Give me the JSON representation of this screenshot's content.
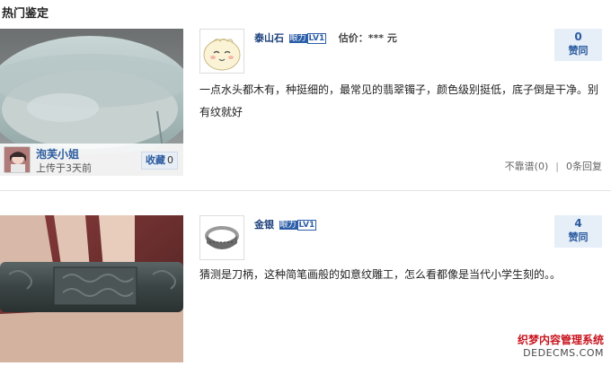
{
  "section": {
    "title": "热门鉴定"
  },
  "items": [
    {
      "uploader": {
        "name": "泡芙小姐",
        "upload_time": "上传于3天前"
      },
      "favorite": {
        "label": "收藏",
        "count": "0"
      },
      "comment": {
        "commenter": "泰山石",
        "eye_badge": [
          "眼力",
          "LV1"
        ],
        "estimate": "估价：*** 元",
        "text": "一点水头都木有，种挺细的，最常见的翡翠镯子，颜色级别挺低，底子倒是干净。别有纹就好"
      },
      "agree": {
        "count": "0",
        "label": "赞同"
      },
      "actions": {
        "unreliable": "不靠谱(0)",
        "separator": "|",
        "replies": "0条回复"
      }
    },
    {
      "comment": {
        "commenter": "金银",
        "eye_badge": [
          "眼力",
          "LV1"
        ],
        "text": "猜测是刀柄，这种简笔画般的如意纹雕工，怎么看都像是当代小学生刻的。。"
      },
      "agree": {
        "count": "4",
        "label": "赞同"
      }
    }
  ],
  "watermark": {
    "line1": "织梦内容管理系统",
    "line2": "DEDECMS.COM"
  },
  "colors": {
    "link_blue": "#2a5a9e",
    "agree_bg": "#e6eef8",
    "watermark_red": "#c8141e"
  }
}
